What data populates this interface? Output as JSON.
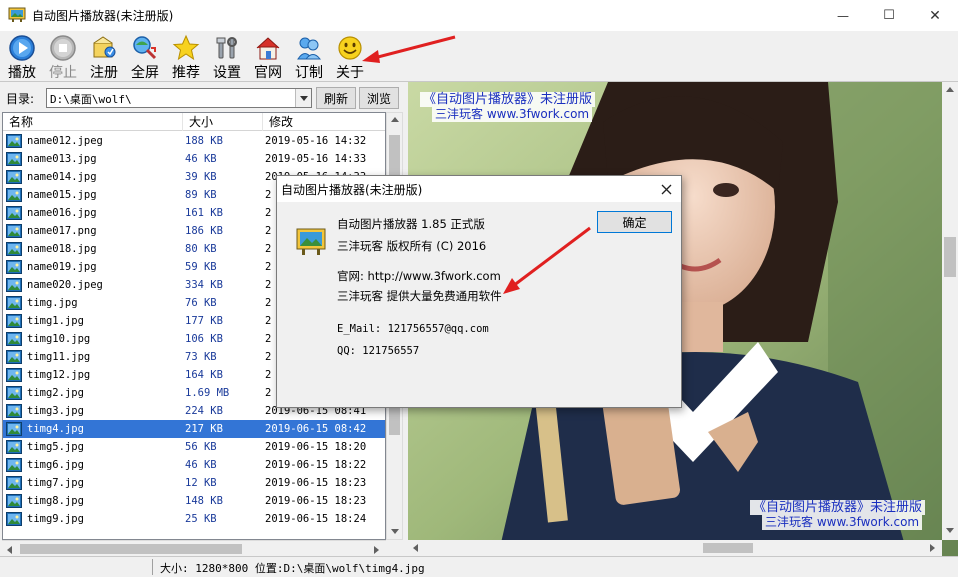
{
  "window": {
    "title": "自动图片播放器(未注册版)",
    "minimize_glyph": "—",
    "maximize_glyph": "☐",
    "close_glyph": "✕"
  },
  "toolbar": {
    "items": [
      {
        "label": "播放",
        "icon": "play-icon",
        "enabled": true
      },
      {
        "label": "停止",
        "icon": "stop-icon",
        "enabled": false
      },
      {
        "label": "注册",
        "icon": "register-icon",
        "enabled": true
      },
      {
        "label": "全屏",
        "icon": "fullscreen-icon",
        "enabled": true
      },
      {
        "label": "推荐",
        "icon": "star-icon",
        "enabled": true
      },
      {
        "label": "设置",
        "icon": "settings-icon",
        "enabled": true
      },
      {
        "label": "官网",
        "icon": "home-icon",
        "enabled": true
      },
      {
        "label": "订制",
        "icon": "users-icon",
        "enabled": true
      },
      {
        "label": "关于",
        "icon": "smiley-icon",
        "enabled": true
      }
    ]
  },
  "directory": {
    "label": "目录:",
    "value": "D:\\桌面\\wolf\\",
    "refresh_label": "刷新",
    "browse_label": "浏览"
  },
  "file_list": {
    "columns": [
      "名称",
      "大小",
      "修改"
    ],
    "rows": [
      {
        "name": "name012.jpeg",
        "size": "188 KB",
        "modified": "2019-05-16 14:32",
        "selected": false
      },
      {
        "name": "name013.jpg",
        "size": "46 KB",
        "modified": "2019-05-16 14:33",
        "selected": false
      },
      {
        "name": "name014.jpg",
        "size": "39 KB",
        "modified": "2019-05-16 14:33",
        "selected": false
      },
      {
        "name": "name015.jpg",
        "size": "89 KB",
        "modified": "2",
        "selected": false
      },
      {
        "name": "name016.jpg",
        "size": "161 KB",
        "modified": "2",
        "selected": false
      },
      {
        "name": "name017.png",
        "size": "186 KB",
        "modified": "2",
        "selected": false
      },
      {
        "name": "name018.jpg",
        "size": "80 KB",
        "modified": "2",
        "selected": false
      },
      {
        "name": "name019.jpg",
        "size": "59 KB",
        "modified": "2",
        "selected": false
      },
      {
        "name": "name020.jpeg",
        "size": "334 KB",
        "modified": "2",
        "selected": false
      },
      {
        "name": "timg.jpg",
        "size": "76 KB",
        "modified": "2",
        "selected": false
      },
      {
        "name": "timg1.jpg",
        "size": "177 KB",
        "modified": "2",
        "selected": false
      },
      {
        "name": "timg10.jpg",
        "size": "106 KB",
        "modified": "2",
        "selected": false
      },
      {
        "name": "timg11.jpg",
        "size": "73 KB",
        "modified": "2",
        "selected": false
      },
      {
        "name": "timg12.jpg",
        "size": "164 KB",
        "modified": "2",
        "selected": false
      },
      {
        "name": "timg2.jpg",
        "size": "1.69 MB",
        "modified": "2",
        "selected": false
      },
      {
        "name": "timg3.jpg",
        "size": "224 KB",
        "modified": "2019-06-15 08:41",
        "selected": false
      },
      {
        "name": "timg4.jpg",
        "size": "217 KB",
        "modified": "2019-06-15 08:42",
        "selected": true
      },
      {
        "name": "timg5.jpg",
        "size": "56 KB",
        "modified": "2019-06-15 18:20",
        "selected": false
      },
      {
        "name": "timg6.jpg",
        "size": "46 KB",
        "modified": "2019-06-15 18:22",
        "selected": false
      },
      {
        "name": "timg7.jpg",
        "size": "12 KB",
        "modified": "2019-06-15 18:23",
        "selected": false
      },
      {
        "name": "timg8.jpg",
        "size": "148 KB",
        "modified": "2019-06-15 18:23",
        "selected": false
      },
      {
        "name": "timg9.jpg",
        "size": "25 KB",
        "modified": "2019-06-15 18:24",
        "selected": false
      }
    ]
  },
  "status": {
    "text": "大小: 1280*800 位置:D:\\桌面\\wolf\\timg4.jpg"
  },
  "viewer": {
    "watermark_top_line1": "《自动图片播放器》未注册版",
    "watermark_top_line2": "三沣玩客 www.3fwork.com",
    "watermark_bottom_line1": "《自动图片播放器》未注册版",
    "watermark_bottom_line2": "三沣玩客 www.3fwork.com"
  },
  "about_dialog": {
    "title": "自动图片播放器(未注册版)",
    "ok_label": "确定",
    "product_line": "自动图片播放器 1.85 正式版",
    "copyright_line": "三沣玩客 版权所有 (C) 2016",
    "website_line": "官网: http://www.3fwork.com",
    "provider_line": "三沣玩客 提供大量免费通用软件",
    "email_line": "E_Mail: 121756557@qq.com",
    "qq_line": "QQ: 121756557"
  },
  "colors": {
    "selection": "#3375d6",
    "annotation_arrow": "#e02020",
    "watermark_text": "#1a2fbf"
  }
}
